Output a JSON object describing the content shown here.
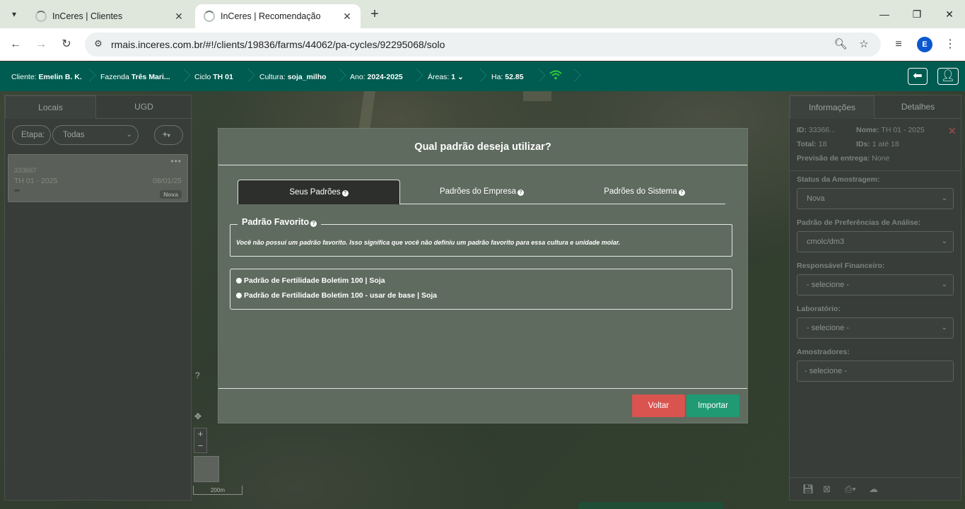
{
  "browser": {
    "tabs": [
      {
        "title": "InCeres | Clientes",
        "active": false
      },
      {
        "title": "InCeres | Recomendação",
        "active": true
      }
    ],
    "url": "rmais.inceres.com.br/#!/clients/19836/farms/44062/pa-cycles/92295068/solo",
    "profile_initial": "E"
  },
  "appbar": {
    "cliente_label": "Cliente:",
    "cliente": "Emelin B. K.",
    "fazenda_label": "Fazenda",
    "fazenda": "Três Mari...",
    "ciclo_label": "Ciclo",
    "ciclo": "TH 01",
    "cultura_label": "Cultura:",
    "cultura": "soja_milho",
    "ano_label": "Ano:",
    "ano": "2024-2025",
    "areas_label": "Áreas:",
    "areas": "1",
    "ha_label": "Ha:",
    "ha": "52.85"
  },
  "left_panel": {
    "tabs": [
      "Locais",
      "UGD"
    ],
    "etapa_label": "Etapa:",
    "etapa_value": "Todas",
    "add_label": "+",
    "card": {
      "id": "333667",
      "name": "TH 01 - 2025",
      "date": "08/01/25",
      "status": "Nova"
    }
  },
  "map": {
    "scale": "200m",
    "help": "?"
  },
  "right_panel": {
    "tabs": [
      "Informações",
      "Detalhes"
    ],
    "id_label": "ID:",
    "id_value": "33366...",
    "nome_label": "Nome:",
    "nome_value": "TH 01 - 2025",
    "total_label": "Total:",
    "total_value": "18",
    "ids_label": "IDs:",
    "ids_value": "1 até 18",
    "previsao_label": "Previsão de entrega:",
    "previsao_value": "None",
    "status_label": "Status da Amostragem:",
    "status_value": "Nova",
    "padrao_label": "Padrão de Preferências de Análise:",
    "padrao_value": "cmolc/dm3",
    "resp_label": "Responsável Financeiro:",
    "resp_value": "- selecione -",
    "lab_label": "Laboratório:",
    "lab_value": "- selecione -",
    "amostr_label": "Amostradores:",
    "amostr_value": "- selecione -"
  },
  "modal": {
    "title": "Qual padrão deseja utilizar?",
    "tabs": [
      "Seus Padrões",
      "Padrões do Empresa",
      "Padrões do Sistema"
    ],
    "favorite_legend": "Padrão Favorito",
    "favorite_message": "Você não possui um padrão favorito. Isso significa que você não definiu um padrão favorito para essa cultura e unidade molar.",
    "options": [
      "Padrão de Fertilidade Boletim 100 | Soja",
      "Padrão de Fertilidade Boletim 100 - usar de base | Soja"
    ],
    "voltar": "Voltar",
    "importar": "Importar"
  },
  "colors": {
    "appbar": "#005b50",
    "voltar": "#d9534f",
    "importar": "#1f9a73",
    "wifi": "#2ecc40"
  }
}
